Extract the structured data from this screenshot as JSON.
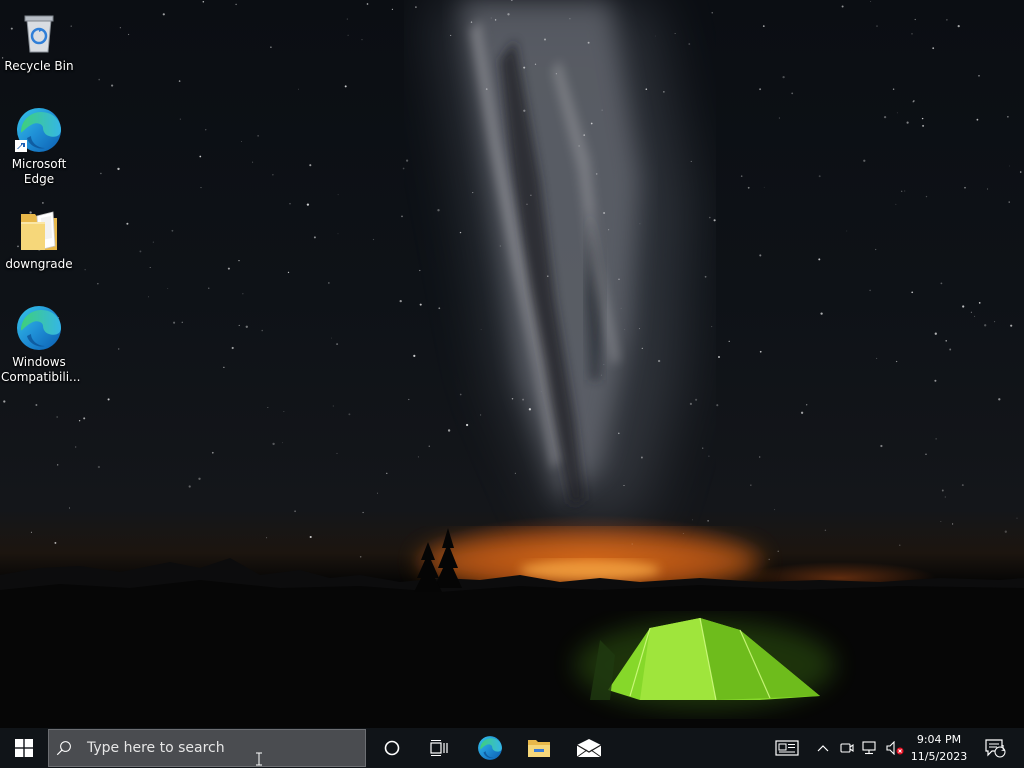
{
  "desktop": {
    "icons": [
      {
        "label": "Recycle Bin",
        "icon": "recycle-bin-icon"
      },
      {
        "label": "Microsoft Edge",
        "icon": "edge-icon"
      },
      {
        "label": "downgrade",
        "icon": "folder-icon"
      },
      {
        "label": "Windows Compatibili...",
        "icon": "edge-icon"
      }
    ]
  },
  "taskbar": {
    "start_icon": "windows-logo-icon",
    "search": {
      "placeholder": "Type here to search",
      "icon": "search-icon"
    },
    "cortana_icon": "cortana-circle-icon",
    "task_view_icon": "task-view-icon",
    "pinned": [
      {
        "name": "Microsoft Edge",
        "icon": "edge-icon"
      },
      {
        "name": "File Explorer",
        "icon": "folder-icon"
      },
      {
        "name": "Mail",
        "icon": "mail-icon"
      }
    ],
    "tray": {
      "news_icon": "news-icon",
      "chevron_icon": "chevron-up-icon",
      "meet_icon": "meet-now-icon",
      "network_icon": "network-icon",
      "volume_icon": "volume-muted-icon",
      "time": "9:04 PM",
      "date": "11/5/2023",
      "notifications_icon": "action-center-icon",
      "notification_count": "1"
    }
  },
  "colors": {
    "taskbar": "#101418",
    "search_box": "#4a4c50",
    "tent_green": "#8ee02a"
  }
}
